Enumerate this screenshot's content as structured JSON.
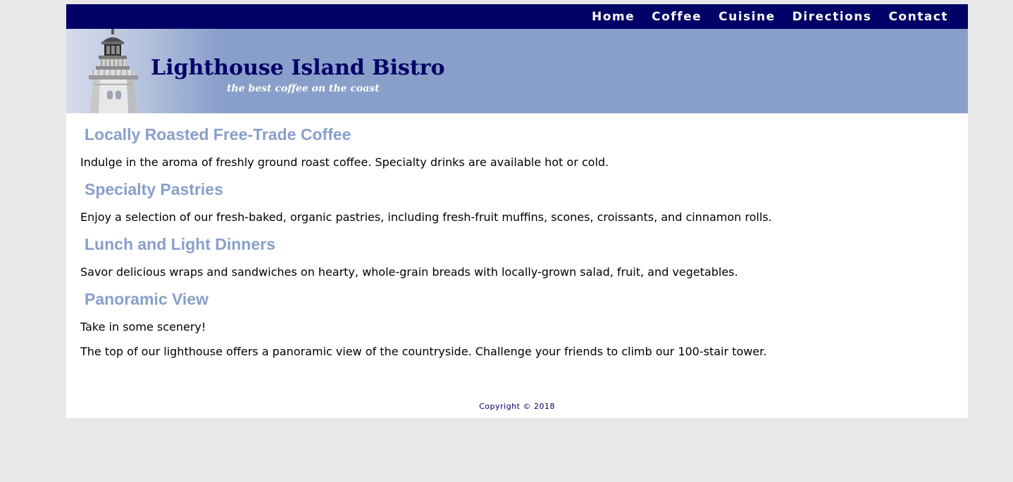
{
  "nav": {
    "items": [
      {
        "label": "Home"
      },
      {
        "label": "Coffee"
      },
      {
        "label": "Cuisine"
      },
      {
        "label": "Directions"
      },
      {
        "label": "Contact"
      }
    ]
  },
  "banner": {
    "title": "Lighthouse Island Bistro",
    "tagline": "the best coffee on the coast",
    "image_icon": "lighthouse-icon"
  },
  "sections": [
    {
      "heading": "Locally Roasted Free-Trade Coffee",
      "paragraphs": [
        "Indulge in the aroma of freshly ground roast coffee. Specialty drinks are available hot or cold."
      ]
    },
    {
      "heading": "Specialty Pastries",
      "paragraphs": [
        "Enjoy a selection of our fresh-baked, organic pastries, including fresh-fruit muffins, scones, croissants, and cinnamon rolls."
      ]
    },
    {
      "heading": "Lunch and Light Dinners",
      "paragraphs": [
        "Savor delicious wraps and sandwiches on hearty, whole-grain breads with locally-grown salad, fruit, and vegetables."
      ]
    },
    {
      "heading": "Panoramic View",
      "paragraphs": [
        "Take in some scenery!",
        "The top of our lighthouse offers a panoramic view of the countryside. Challenge your friends to climb our 100-stair tower."
      ]
    }
  ],
  "footer": {
    "copyright": "Copyright © 2018"
  },
  "colors": {
    "nav_bg": "#000066",
    "banner_bg": "#889fca",
    "heading": "#889fca",
    "page_bg": "#e8e8e8"
  }
}
